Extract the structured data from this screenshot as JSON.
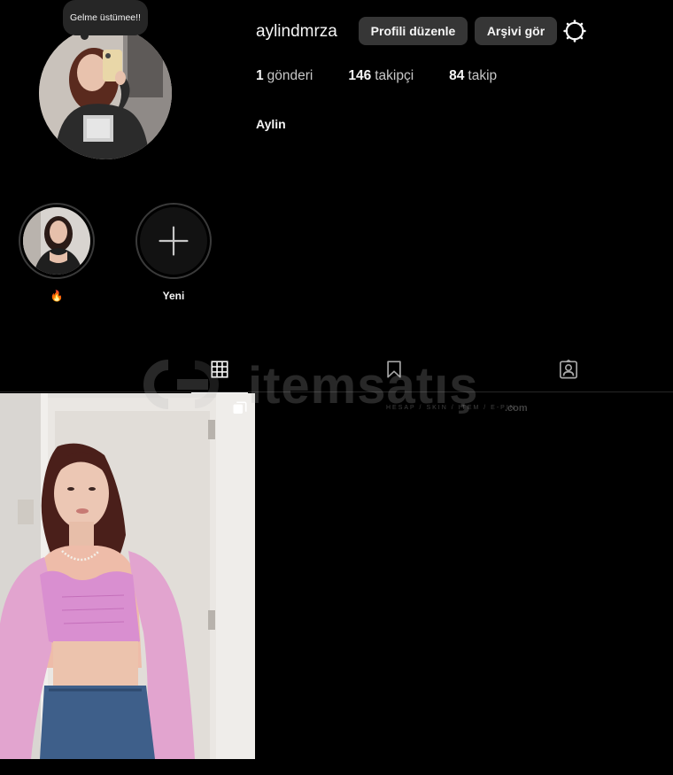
{
  "profile": {
    "username": "aylindmrza",
    "full_name": "Aylin",
    "note": "Gelme üstümee!!",
    "edit_profile_label": "Profili düzenle",
    "archive_label": "Arşivi gör",
    "stats": {
      "posts_count": "1",
      "posts_label": "gönderi",
      "followers_count": "146",
      "followers_label": "takipçi",
      "following_count": "84",
      "following_label": "takip"
    }
  },
  "highlights": [
    {
      "label": "🔥",
      "icon": "photo-thumbnail"
    },
    {
      "label": "Yeni",
      "icon": "plus-icon"
    }
  ],
  "tabs": [
    {
      "name": "posts",
      "icon": "grid-icon",
      "active": true
    },
    {
      "name": "saved",
      "icon": "bookmark-icon",
      "active": false
    },
    {
      "name": "tagged",
      "icon": "tagged-user-icon",
      "active": false
    }
  ],
  "watermark": {
    "text": "itemsatış",
    "sub": "HESAP / SKIN / ITEM / E-PIN",
    "com": ".com"
  },
  "posts": [
    {
      "type": "carousel",
      "icon": "carousel-icon"
    }
  ],
  "colors": {
    "background": "#000000",
    "button": "#363636",
    "text": "#f5f5f5",
    "divider": "#262626"
  }
}
